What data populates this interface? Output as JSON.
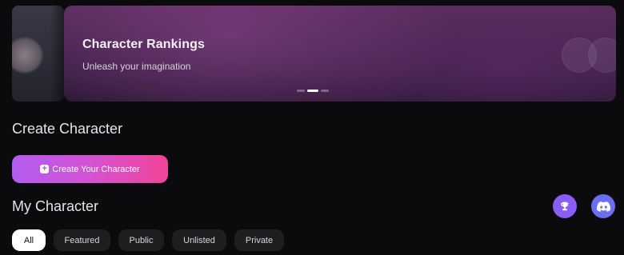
{
  "banner": {
    "title": "Character Rankings",
    "subtitle": "Unleash your imagination",
    "slide_count": 3,
    "active_slide": 2
  },
  "create_section": {
    "title": "Create Character",
    "button_label": "Create Your Character",
    "button_gradient": [
      "#b25cf2",
      "#f04496"
    ]
  },
  "my_section": {
    "title": "My Character",
    "icons": [
      "trophy-icon",
      "discord-icon"
    ],
    "filters": [
      "All",
      "Featured",
      "Public",
      "Unlisted",
      "Private"
    ],
    "active_filter": "All"
  },
  "colors": {
    "background": "#0b0a0c",
    "trophy_button": "#8b5cf6",
    "discord_button": "#6a6ff0"
  }
}
